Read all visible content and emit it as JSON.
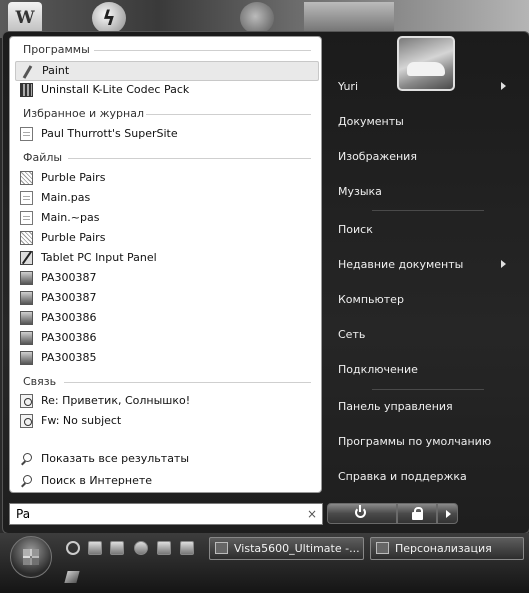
{
  "left": {
    "sections": [
      {
        "title": "Программы",
        "items": [
          {
            "label": "Paint",
            "icon": "paint-icon",
            "highlight": true
          },
          {
            "label": "Uninstall K-Lite Codec Pack",
            "icon": "film-icon"
          }
        ]
      },
      {
        "title": "Избранное и журнал",
        "items": [
          {
            "label": "Paul Thurrott's SuperSite",
            "icon": "document-icon"
          }
        ]
      },
      {
        "title": "Файлы",
        "items": [
          {
            "label": "Purble Pairs",
            "icon": "card-icon"
          },
          {
            "label": "Main.pas",
            "icon": "document-icon"
          },
          {
            "label": "Main.~pas",
            "icon": "document-icon"
          },
          {
            "label": "Purble Pairs",
            "icon": "card-icon"
          },
          {
            "label": "Tablet PC Input Panel",
            "icon": "tablet-icon"
          },
          {
            "label": "PA300387",
            "icon": "image-icon"
          },
          {
            "label": "PA300387",
            "icon": "image-icon"
          },
          {
            "label": "PA300386",
            "icon": "image-icon"
          },
          {
            "label": "PA300386",
            "icon": "image-icon"
          },
          {
            "label": "PA300385",
            "icon": "image-icon"
          }
        ]
      },
      {
        "title": "Связь",
        "items": [
          {
            "label": "Re: Приветик, Солнышко!",
            "icon": "mail-icon"
          },
          {
            "label": "Fw: No subject",
            "icon": "mail-icon"
          }
        ]
      }
    ],
    "show_all": "Показать все результаты",
    "search_internet": "Поиск в Интернете"
  },
  "right": {
    "items": [
      {
        "label": "Yuri",
        "arrow": true
      },
      {
        "label": "Документы"
      },
      {
        "label": "Изображения"
      },
      {
        "label": "Музыка"
      },
      {
        "label": "Поиск"
      },
      {
        "label": "Недавние документы",
        "arrow": true
      },
      {
        "label": "Компьютер"
      },
      {
        "label": "Сеть"
      },
      {
        "label": "Подключение"
      },
      {
        "label": "Панель управления"
      },
      {
        "label": "Программы по умолчанию"
      },
      {
        "label": "Справка и поддержка"
      }
    ]
  },
  "search": {
    "value": "Pa",
    "clear_glyph": "×"
  },
  "taskbar": {
    "tasks": [
      {
        "label": "Vista5600_Ultimate -..."
      },
      {
        "label": "Персонализация"
      }
    ]
  }
}
